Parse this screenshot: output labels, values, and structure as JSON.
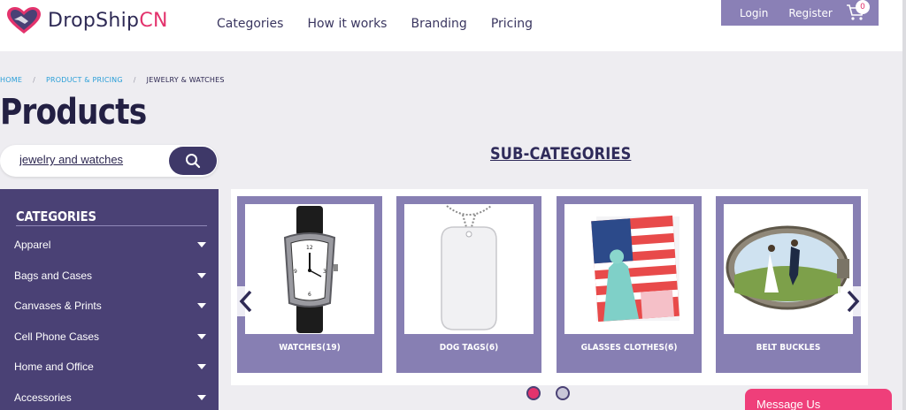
{
  "brand": {
    "part1": "DropShip",
    "part2": "CN",
    "accent": "#e3336d",
    "primary": "#2e2a55"
  },
  "nav": [
    "Categories",
    "How it works",
    "Branding",
    "Pricing"
  ],
  "auth": {
    "login": "Login",
    "register": "Register",
    "cart_count": "0",
    "cart_icon": "cart-icon"
  },
  "breadcrumb": {
    "home": "HOME",
    "section": "PRODUCT & PRICING",
    "current": "JEWELRY & WATCHES",
    "sep": "/"
  },
  "page_title": "Products",
  "search": {
    "value": "jewelry and watches",
    "icon": "search-icon"
  },
  "sidebar": {
    "title": "CATEGORIES",
    "items": [
      "Apparel",
      "Bags and Cases",
      "Canvases & Prints",
      "Cell Phone Cases",
      "Home and Office",
      "Accessories"
    ]
  },
  "subcategories": {
    "title": "SUB-CATEGORIES",
    "cards": [
      "WATCHES(19)",
      "DOG TAGS(6)",
      "GLASSES CLOTHES(6)",
      "BELT BUCKLES"
    ]
  },
  "message_button": "Message Us"
}
